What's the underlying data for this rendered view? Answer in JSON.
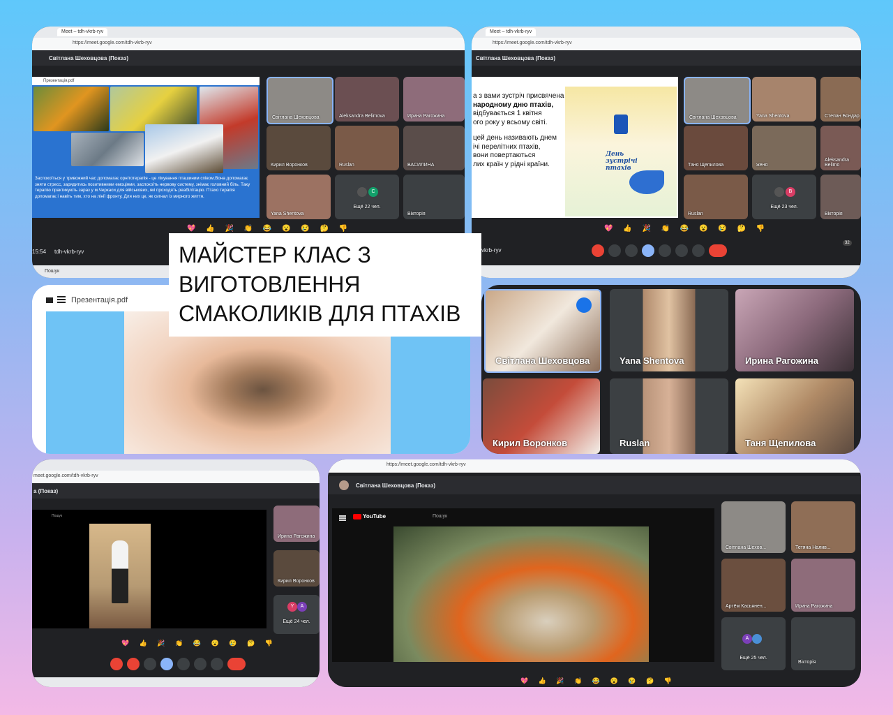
{
  "title_card": {
    "line1": "МАЙСТЕР КЛАС З",
    "line2": "ВИГОТОВЛЕННЯ",
    "line3": "СМАКОЛИКІВ ДЛЯ ПТАХІВ"
  },
  "p1": {
    "tab": "Meet – tdh-vkrb-ryv",
    "url": "https://meet.google.com/tdh-vkrb-ryv",
    "presenter": "Світлана Шеховцова (Показ)",
    "doc": "Презентація.pdf",
    "slide_text": "Заспокоїться у тривожний час допомагає орнітотерапія - це лікування пташиним співом.Вона допомагає зняти стресс, зарядитись позитивними емоціями, заспокоїть нервову систему, знімає головний біль. Таку терапію практикують зараз у м.Черкаси для військових, які проходять реабілітацію. Птахо терапія допомагає і навіть тим, хто на лінії фронту. Для них це, як сигнал із мирного життя.",
    "tiles": [
      "Світлана Шеховцова",
      "Aleksandra Belimova",
      "Ирина Рагожина",
      "Кирил Воронков",
      "Ruslan",
      "ВАСИЛИНА",
      "Yana Shentova",
      "Ещё 22 чел.",
      "Вікторія"
    ],
    "avatar_c": "C",
    "time": "15:54",
    "meet_code": "tdh-vkrb-ryv",
    "search": "Пошук"
  },
  "p2": {
    "tab": "Meet – tdh-vkrb-ryv",
    "url": "https://meet.google.com/tdh-vkrb-ryv",
    "presenter": "Світлана Шеховцова (Показ)",
    "slide_lines": [
      "а з вами зустріч присвячена",
      "народному дню птахів,",
      "відбувається 1 квітня",
      "ого року у всьому світі.",
      "цей день називають днем",
      "ічі перелітних птахів,",
      "вони повертаються",
      "лих країн  у рідні країни."
    ],
    "poster": "День зустрічі птахів",
    "tiles": [
      "Світлана Шеховцова",
      "Yana Shentova",
      "Степан Бондар",
      "Таня Щепилова",
      "женя",
      "Aleksandra Belimo",
      "Ruslan",
      "Ещё 23 чел.",
      "Вікторія"
    ],
    "avatar_b": "B",
    "meet_code": "vkrb-ryv",
    "count": "32"
  },
  "p3": {
    "doc": "Презентація.pdf"
  },
  "p4": {
    "tiles": [
      "Світлана Шеховцова",
      "Yana Shentova",
      "Ирина Рагожина",
      "Кирил Воронков",
      "Ruslan",
      "Таня Щепилова"
    ]
  },
  "p5": {
    "url": "meet.google.com/tdh-vkrb-ryv",
    "presenter": "а (Показ)",
    "search": "Пошук",
    "tiles": [
      "Ирина Рагожина",
      "Кирил Воронков",
      "Ещё 24 чел."
    ],
    "av1": "Y",
    "av2": "A"
  },
  "p6": {
    "url": "https://meet.google.com/tdh-vkrb-ryv",
    "presenter": "Світлана Шеховцова (Показ)",
    "youtube": "YouTube",
    "search": "Пошук",
    "tiles": [
      "Світлана Шехов...",
      "Тетяна Налив...",
      "Артём Касьянен...",
      "Ирина Рагожина",
      "Ещё 25 чел.",
      "Вікторія"
    ],
    "av": "A"
  },
  "emoji_row": "💖 👍 🎉 👏 😂 😮 😢 🤔 👎",
  "colors": {
    "bg_top": "#5fc8fb",
    "bg_bottom": "#f3b9e6",
    "meet_dark": "#202124",
    "end_call": "#ea4335"
  }
}
